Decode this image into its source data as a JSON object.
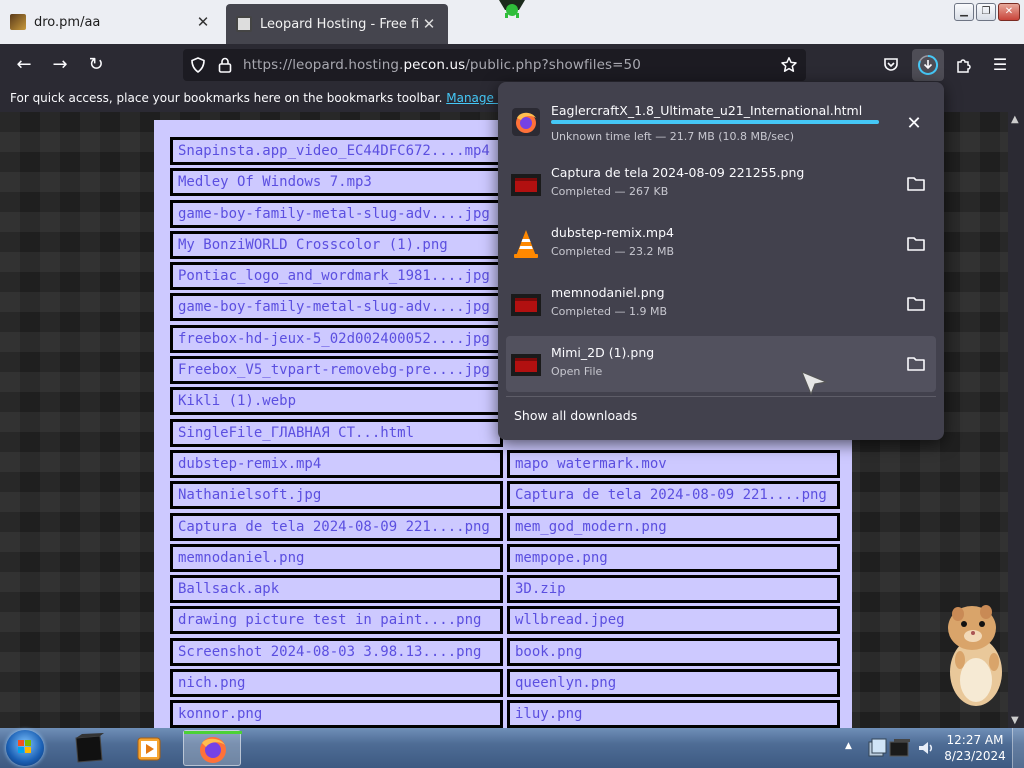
{
  "browser": {
    "tabs": [
      {
        "label": "dro.pm/aa",
        "active": false
      },
      {
        "label": "Leopard Hosting - Free file hosting",
        "active": true
      }
    ],
    "url": {
      "prefix": "https://leopard.hosting.",
      "domain": "pecon.us",
      "suffix": "/public.php?showfiles=50"
    },
    "bookmarks_bar": {
      "text": "For quick access, place your bookmarks here on the bookmarks toolbar.",
      "link": "Manage bookmarks..."
    }
  },
  "files": [
    [
      "Snapinsta.app_video_EC44DFC672....mp4",
      ""
    ],
    [
      "Medley Of Windows 7.mp3",
      ""
    ],
    [
      "game-boy-family-metal-slug-adv....jpg",
      ""
    ],
    [
      "My BonziWORLD Crosscolor (1).png",
      ""
    ],
    [
      "Pontiac_logo_and_wordmark_1981....jpg",
      ""
    ],
    [
      "game-boy-family-metal-slug-adv....jpg",
      ""
    ],
    [
      "freebox-hd-jeux-5_02d002400052....jpg",
      ""
    ],
    [
      "Freebox_V5_tvpart-removebg-pre....jpg",
      ""
    ],
    [
      "Kikli (1).webp",
      ""
    ],
    [
      "SingleFile_ГЛАВНАЯ СТ...html",
      ""
    ],
    [
      "dubstep-remix.mp4",
      "mapo watermark.mov"
    ],
    [
      "Nathanielsoft.jpg",
      "Captura de tela 2024-08-09 221....png"
    ],
    [
      "Captura de tela 2024-08-09 221....png",
      "mem_god_modern.png"
    ],
    [
      "memnodaniel.png",
      "mempope.png"
    ],
    [
      "Ballsack.apk",
      "3D.zip"
    ],
    [
      "drawing picture test in paint....png",
      "wllbread.jpeg"
    ],
    [
      "Screenshot 2024-08-03 3.98.13....png",
      "book.png"
    ],
    [
      "nich.png",
      "queenlyn.png"
    ],
    [
      "konnor.png",
      "iluy.png"
    ]
  ],
  "downloads": {
    "items": [
      {
        "name": "EaglercraftX_1.8_Ultimate_u21_International.html",
        "status": "Unknown time left — 21.7 MB (10.8 MB/sec)",
        "icon": "firefox-icon",
        "in_progress": true,
        "progress_pct": 100
      },
      {
        "name": "Captura de tela 2024-08-09 221255.png",
        "status": "Completed — 267 KB",
        "icon": "image-file-icon"
      },
      {
        "name": "dubstep-remix.mp4",
        "status": "Completed — 23.2 MB",
        "icon": "vlc-icon"
      },
      {
        "name": "memnodaniel.png",
        "status": "Completed — 1.9 MB",
        "icon": "image-file-icon"
      },
      {
        "name": "Mimi_2D (1).png",
        "status": "Open File",
        "icon": "image-file-icon",
        "hovered": true
      }
    ],
    "show_all": "Show all downloads"
  },
  "taskbar": {
    "clock_time": "12:27 AM",
    "clock_date": "8/23/2024"
  },
  "colors": {
    "panel_bg": "#cdc9ff",
    "file_text": "#5b4fe0",
    "accent": "#45c8f7",
    "popup_bg": "#42414d"
  }
}
